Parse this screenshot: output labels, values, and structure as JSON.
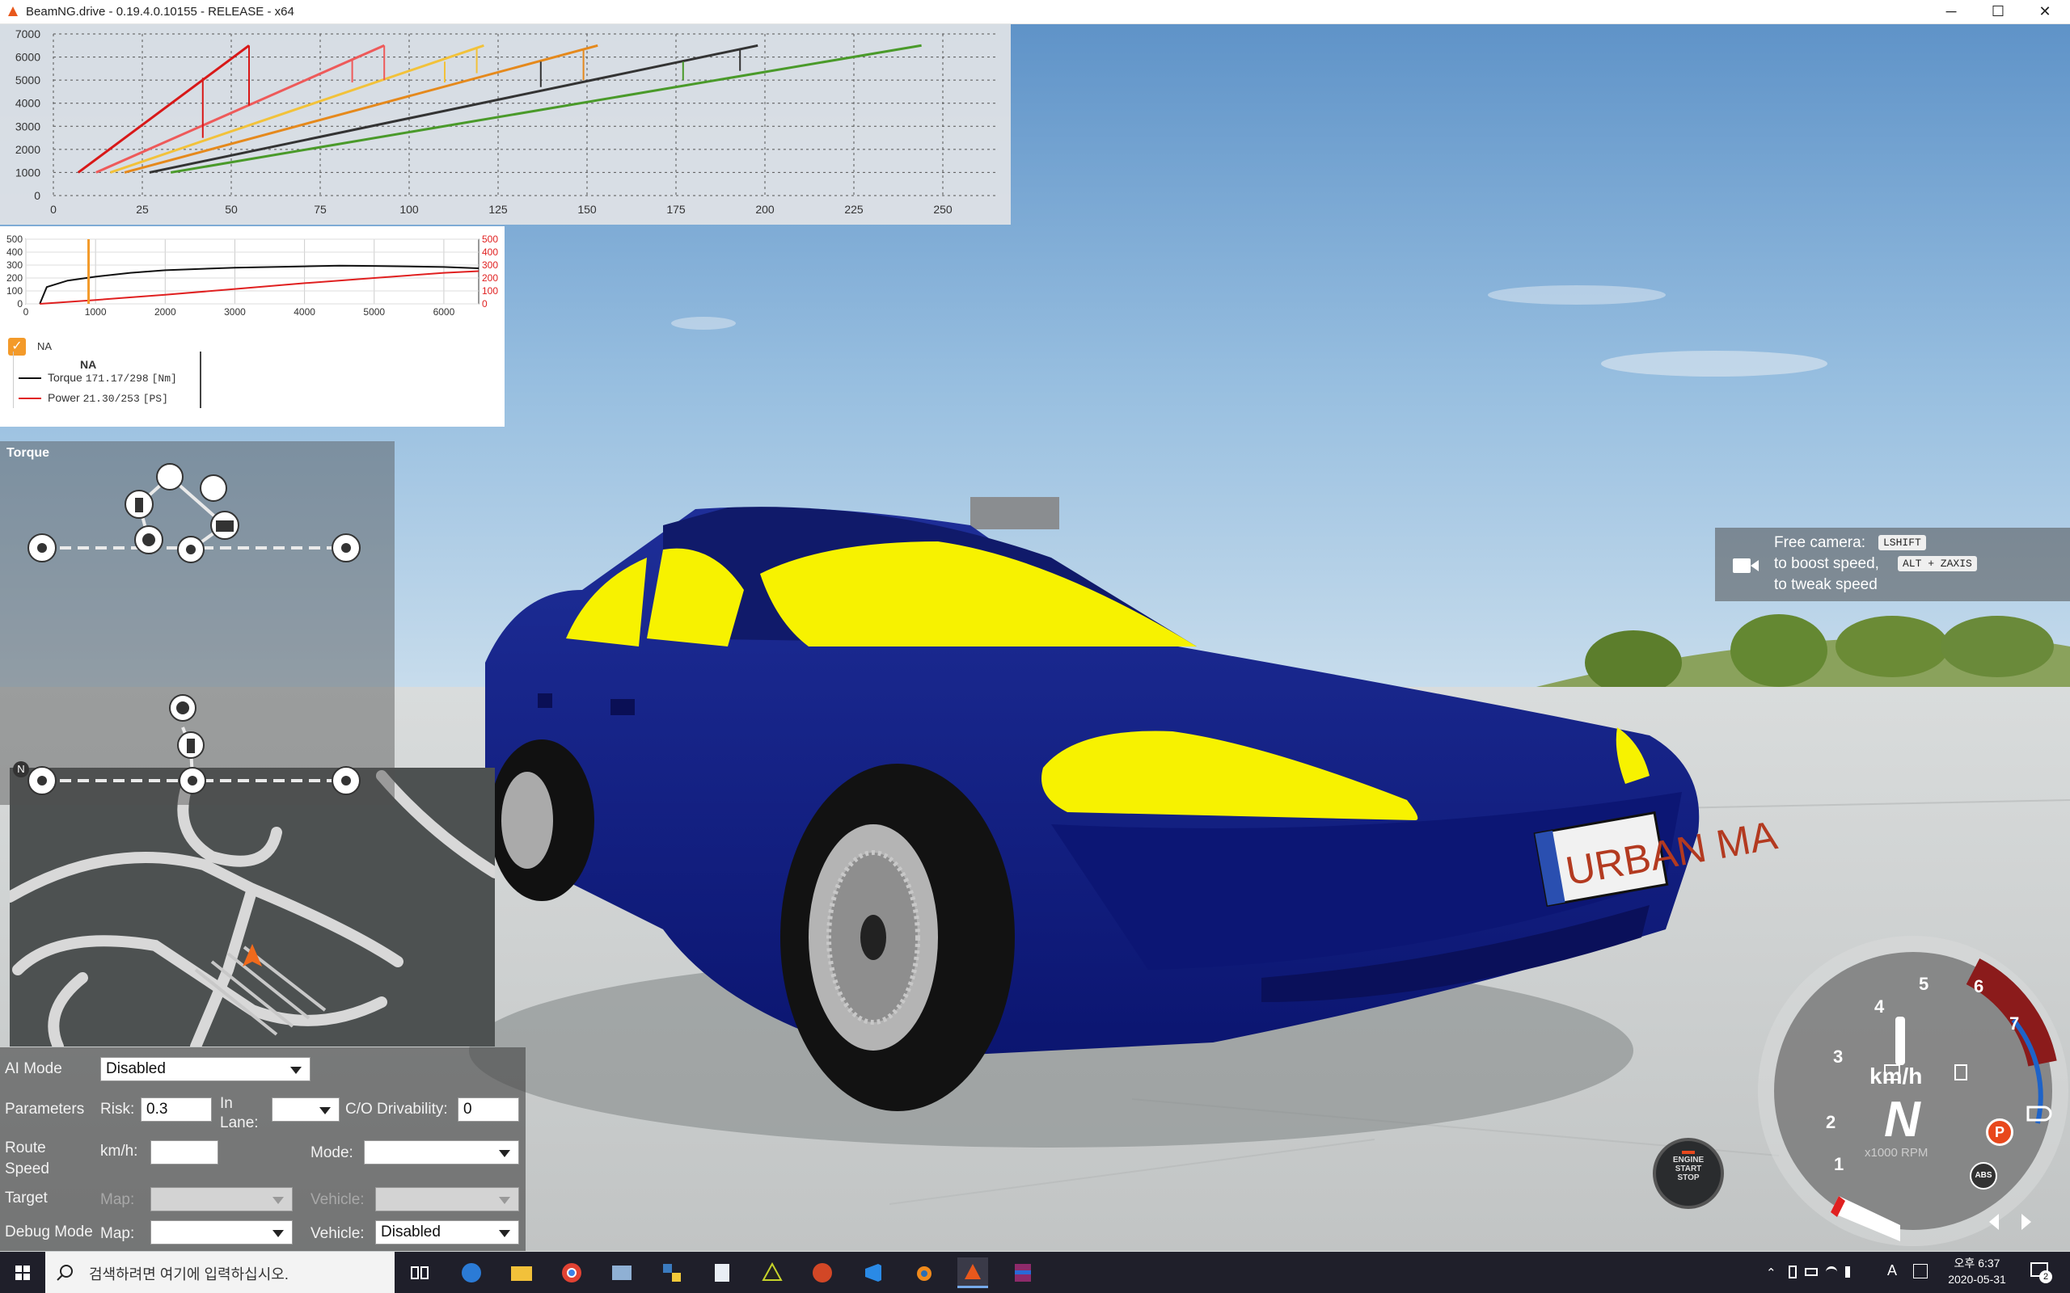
{
  "window": {
    "title": "BeamNG.drive - 0.19.4.0.10155 - RELEASE - x64",
    "minimize": "─",
    "maximize": "☐",
    "close": "✕"
  },
  "gear_chart": {
    "y_ticks": [
      "7000",
      "6000",
      "5000",
      "4000",
      "3000",
      "2000",
      "1000",
      "0"
    ],
    "x_ticks": [
      "0",
      "25",
      "50",
      "75",
      "100",
      "125",
      "150",
      "175",
      "200",
      "225",
      "250"
    ],
    "series_colors": [
      "#d81818",
      "#ee5a5a",
      "#f2c23a",
      "#e5891c",
      "#333333",
      "#4a9a2a"
    ]
  },
  "chart_data": [
    {
      "type": "line",
      "title": "",
      "xlabel": "",
      "ylabel": "",
      "xlim": [
        0,
        265
      ],
      "ylim": [
        0,
        7000
      ],
      "series": [
        {
          "color": "#d81818",
          "points": [
            [
              7,
              1000
            ],
            [
              55,
              6500
            ]
          ]
        },
        {
          "color": "#ee5a5a",
          "points": [
            [
              12,
              1000
            ],
            [
              93,
              6500
            ]
          ]
        },
        {
          "color": "#f2c23a",
          "points": [
            [
              16,
              1000
            ],
            [
              121,
              6500
            ]
          ]
        },
        {
          "color": "#e5891c",
          "points": [
            [
              20,
              1000
            ],
            [
              153,
              6500
            ]
          ]
        },
        {
          "color": "#333333",
          "points": [
            [
              27,
              1000
            ],
            [
              198,
              6500
            ]
          ]
        },
        {
          "color": "#4a9a2a",
          "points": [
            [
              33,
              1000
            ],
            [
              244,
              6500
            ]
          ]
        }
      ],
      "shift_drops": [
        {
          "color": "#d81818",
          "x": 42,
          "from": 5100,
          "to": 2500
        },
        {
          "color": "#d81818",
          "x": 55,
          "from": 6500,
          "to": 3900
        },
        {
          "color": "#ee5a5a",
          "x": 84,
          "from": 5900,
          "to": 4900
        },
        {
          "color": "#ee5a5a",
          "x": 93,
          "from": 6500,
          "to": 5000
        },
        {
          "color": "#f2c23a",
          "x": 110,
          "from": 5800,
          "to": 4900
        },
        {
          "color": "#f2c23a",
          "x": 119,
          "from": 6400,
          "to": 5300
        },
        {
          "color": "#e5891c",
          "x": 149,
          "from": 6300,
          "to": 5000
        },
        {
          "color": "#333333",
          "x": 137,
          "from": 5800,
          "to": 4700
        },
        {
          "color": "#333333",
          "x": 193,
          "from": 6300,
          "to": 5400
        },
        {
          "color": "#4a9a2a",
          "x": 177,
          "from": 5800,
          "to": 5000
        }
      ],
      "grid": true
    },
    {
      "type": "line",
      "title": "",
      "xlabel": "",
      "ylabel": "",
      "x_ticks": [
        "0",
        "1000",
        "2000",
        "3000",
        "4000",
        "5000",
        "6000"
      ],
      "y_ticks_left": [
        "500",
        "400",
        "300",
        "200",
        "100",
        "0"
      ],
      "y_ticks_right": [
        "500",
        "400",
        "300",
        "200",
        "100",
        "0"
      ],
      "xlim": [
        0,
        6500
      ],
      "ylim": [
        0,
        500
      ],
      "series": [
        {
          "name": "Torque",
          "color": "#111111",
          "x": [
            200,
            300,
            600,
            1000,
            1500,
            2000,
            3000,
            4000,
            4500,
            5000,
            6000,
            6500
          ],
          "values": [
            0,
            130,
            180,
            210,
            240,
            260,
            280,
            290,
            295,
            293,
            285,
            275
          ]
        },
        {
          "name": "Power",
          "color": "#e02020",
          "x": [
            200,
            1000,
            2000,
            3000,
            4000,
            5000,
            6000,
            6500
          ],
          "values": [
            0,
            30,
            70,
            115,
            160,
            200,
            240,
            253
          ]
        }
      ],
      "current_rpm_marker": 900,
      "grid": true
    }
  ],
  "torque_curve_panel": {
    "checkbox_label": "NA",
    "legend_title": "NA",
    "legend": [
      {
        "label": "Torque",
        "value": "171.17/298",
        "unit": "[Nm]",
        "color": "#111111"
      },
      {
        "label": "Power",
        "value": "21.30/253",
        "unit": "[PS]",
        "color": "#e02020"
      }
    ]
  },
  "torque_diagram": {
    "title": "Torque",
    "n_badge": "N"
  },
  "camera_hint": {
    "line1": "Free camera:",
    "key1": "LSHIFT",
    "line2": "to boost speed,",
    "key2": "ALT + ZAXIS",
    "line3": "to tweak speed"
  },
  "ai_panel": {
    "ai_mode_label": "AI Mode",
    "ai_mode_value": "Disabled",
    "parameters_label": "Parameters",
    "risk_label": "Risk:",
    "risk_value": "0.3",
    "in_lane_label": "In Lane:",
    "in_lane_value": "",
    "drivability_label": "C/O Drivability:",
    "drivability_value": "0",
    "route_speed_label": "Route Speed",
    "kmh_label": "km/h:",
    "kmh_value": "",
    "mode_label": "Mode:",
    "mode_value": "",
    "target_label": "Target",
    "target_map_label": "Map:",
    "target_vehicle_label": "Vehicle:",
    "debug_label": "Debug Mode",
    "debug_map_label": "Map:",
    "debug_map_value": "",
    "debug_vehicle_label": "Vehicle:",
    "debug_vehicle_value": "Disabled"
  },
  "license_plate": "URBAN MA",
  "dashboard": {
    "ignition_line1": "ENGINE",
    "ignition_line2": "START",
    "ignition_line3": "STOP",
    "rpm_numbers": [
      "1",
      "2",
      "3",
      "4",
      "5",
      "6",
      "7"
    ],
    "speed_value": "I",
    "speed_unit": "km/h",
    "gear": "N",
    "rpm_unit": "x1000 RPM",
    "abs_label": "ABS",
    "parking_label": "P",
    "redline_from": 6.5,
    "colors": {
      "redline": "#8b1b1b",
      "blue_arc": "#1e63c8",
      "parking": "#e8481c"
    }
  },
  "taskbar": {
    "search_placeholder": "검색하려면 여기에 입력하십시오.",
    "time": "오후 6:37",
    "date": "2020-05-31",
    "ime": "A",
    "notification_count": "2"
  }
}
